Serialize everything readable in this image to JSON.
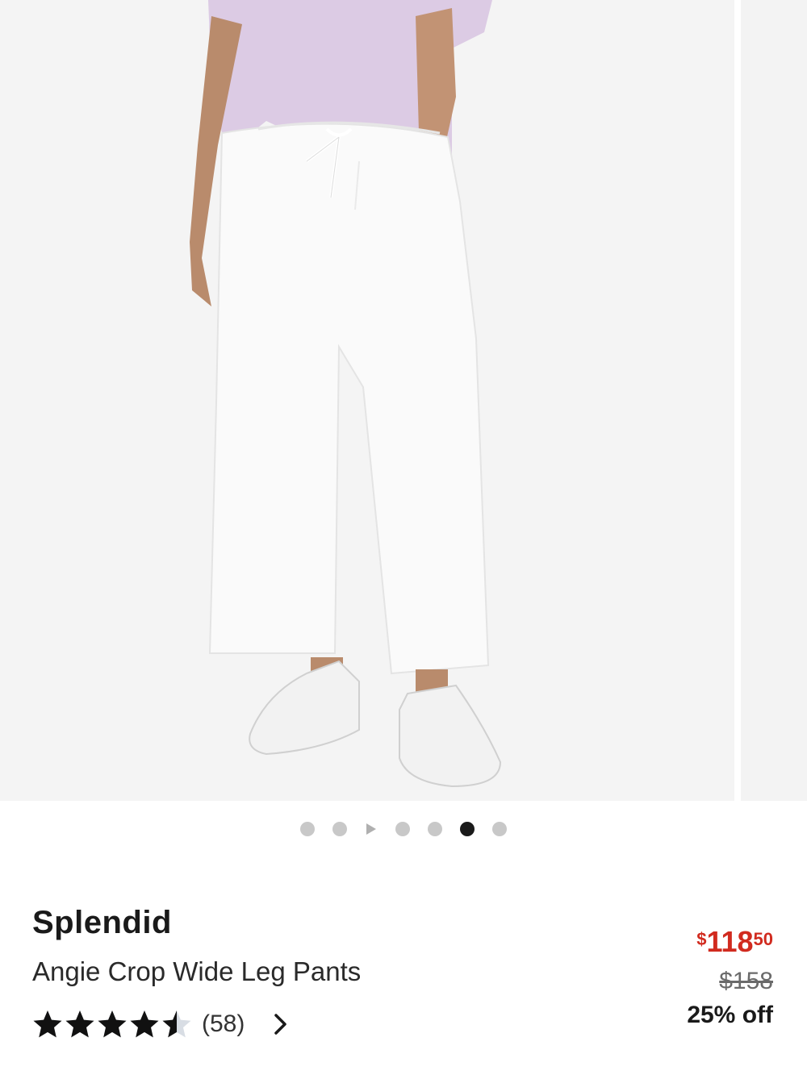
{
  "gallery": {
    "image_count": 7,
    "active_index": 5,
    "video_index": 2
  },
  "product": {
    "brand": "Splendid",
    "name": "Angie Crop Wide Leg Pants"
  },
  "rating": {
    "value": 4.5,
    "max": 5,
    "review_count": "(58)"
  },
  "price": {
    "currency": "$",
    "sale_whole": "118",
    "sale_cents": "50",
    "original": "$158",
    "discount": "25% off"
  },
  "colors": {
    "sale": "#d12b1f",
    "star": "#111111",
    "dot_inactive": "#c8c8c8",
    "dot_active": "#1a1a1a"
  }
}
